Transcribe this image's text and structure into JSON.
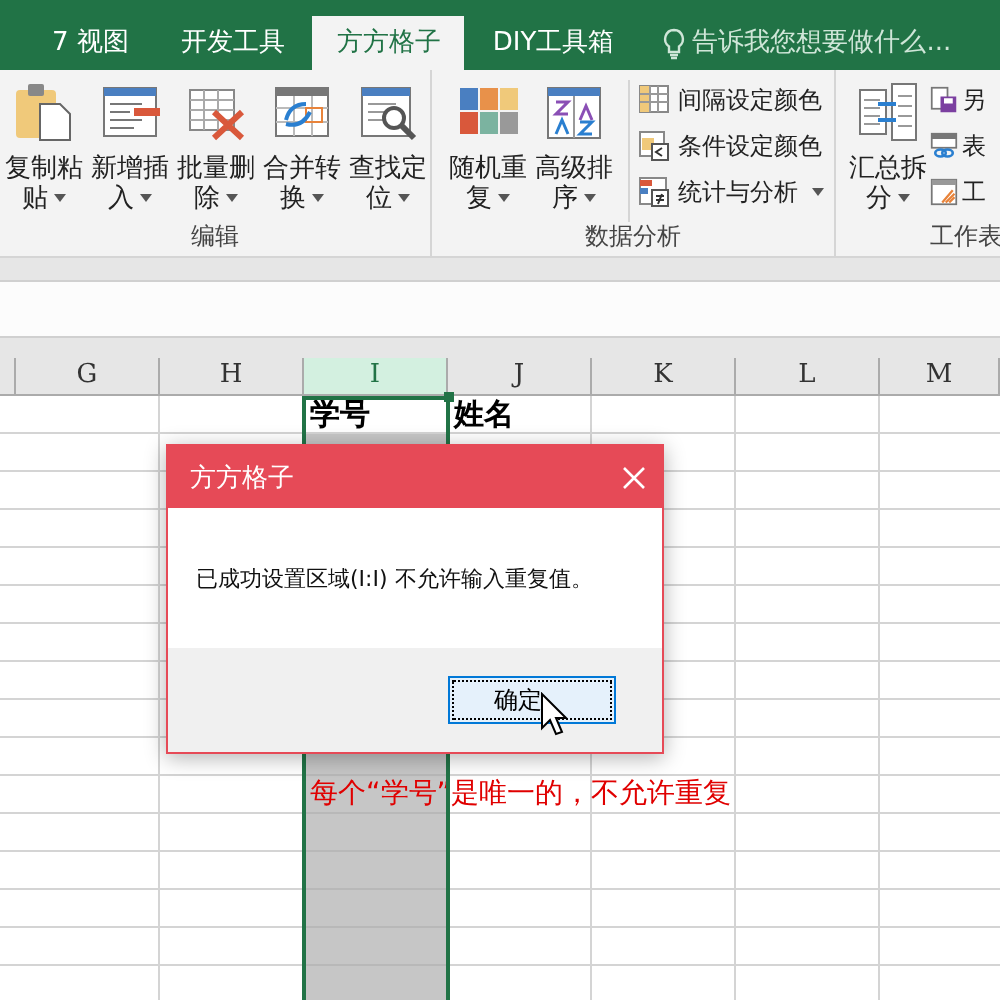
{
  "tabs": [
    {
      "label": "7 视图",
      "selected": false
    },
    {
      "label": "开发工具",
      "selected": false
    },
    {
      "label": "方方格子",
      "selected": true
    },
    {
      "label": "DIY工具箱",
      "selected": false
    }
  ],
  "tell_me": {
    "placeholder": "告诉我您想要做什么..."
  },
  "ribbon_groups": [
    {
      "label": "编辑",
      "items": [
        {
          "kind": "large",
          "label": "复制粘贴",
          "dropdown": true
        },
        {
          "kind": "large",
          "label": "新增插入",
          "dropdown": true
        },
        {
          "kind": "large",
          "label": "批量删除",
          "dropdown": true
        },
        {
          "kind": "large",
          "label": "合并转换",
          "dropdown": true
        },
        {
          "kind": "large",
          "label": "查找定位",
          "dropdown": true
        }
      ]
    },
    {
      "label": "数据分析",
      "items": [
        {
          "kind": "large",
          "label": "随机重复",
          "dropdown": true
        },
        {
          "kind": "large",
          "label": "高级排序",
          "dropdown": true
        },
        {
          "kind": "small",
          "label": "间隔设定颜色",
          "dropdown": false
        },
        {
          "kind": "small",
          "label": "条件设定颜色",
          "dropdown": false
        },
        {
          "kind": "small",
          "label": "统计与分析",
          "dropdown": true
        }
      ]
    },
    {
      "label": "工作表",
      "items": [
        {
          "kind": "large",
          "label": "汇总拆分",
          "dropdown": true
        },
        {
          "kind": "small",
          "label": "另",
          "dropdown": false
        },
        {
          "kind": "small",
          "label": "表",
          "dropdown": false
        },
        {
          "kind": "small",
          "label": "工",
          "dropdown": false
        }
      ]
    }
  ],
  "columns": [
    {
      "label": "G",
      "selected": false
    },
    {
      "label": "H",
      "selected": false
    },
    {
      "label": "I",
      "selected": true
    },
    {
      "label": "J",
      "selected": false
    },
    {
      "label": "K",
      "selected": false
    },
    {
      "label": "L",
      "selected": false
    },
    {
      "label": "M",
      "selected": false
    }
  ],
  "headings": [
    "学号",
    "姓名"
  ],
  "note": "每个“学号”是唯一的，不允许重复",
  "dialog": {
    "title": "方方格子",
    "message": "已成功设置区域(I:I) 不允许输入重复值。",
    "buttons": [
      {
        "label": "确定",
        "focused": true
      }
    ]
  }
}
